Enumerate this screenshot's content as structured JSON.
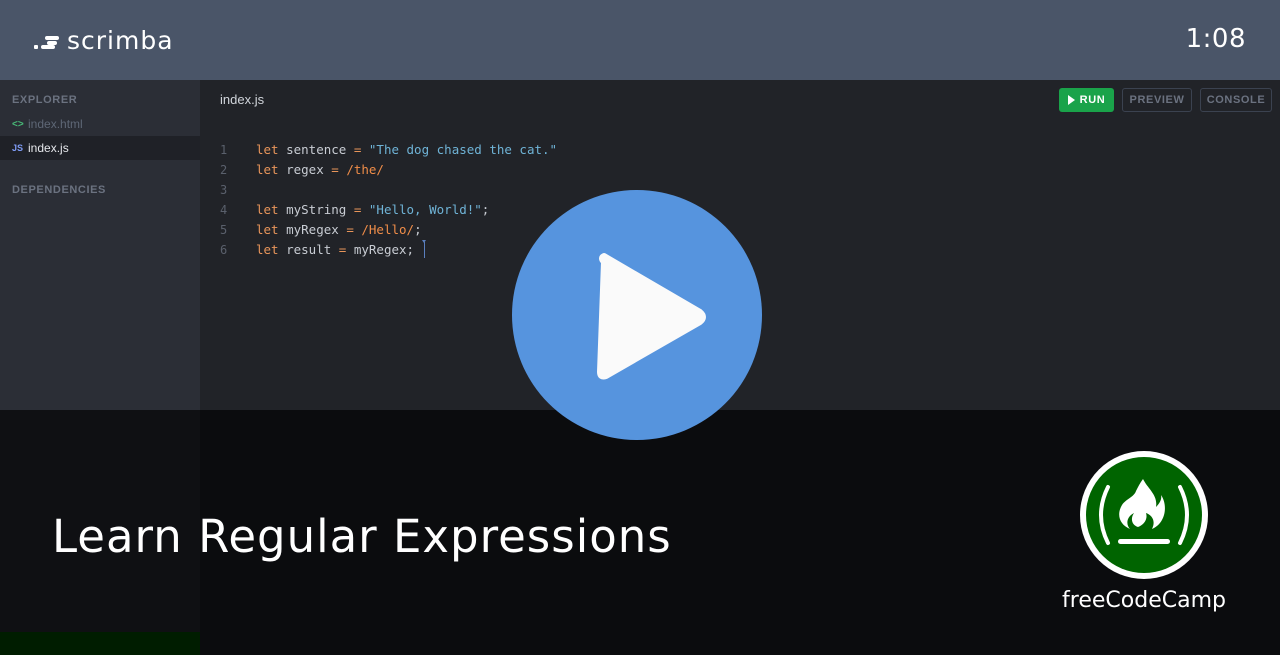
{
  "header": {
    "brand": "scrimba",
    "timer": "1:08"
  },
  "sidebar": {
    "explorer_title": "EXPLORER",
    "files": [
      {
        "name": "index.html",
        "icon": "code-brackets-icon",
        "active": false
      },
      {
        "name": "index.js",
        "icon": "js-icon",
        "active": true
      }
    ],
    "dependencies_title": "DEPENDENCIES",
    "html_icon_glyph": "<>",
    "js_icon_glyph": "JS"
  },
  "editor": {
    "tab_name": "index.js",
    "buttons": {
      "run": "RUN",
      "preview": "PREVIEW",
      "console": "CONSOLE"
    },
    "lines": [
      {
        "n": "1",
        "tokens": [
          [
            "kw",
            "let"
          ],
          [
            "tx",
            " sentence "
          ],
          [
            "kw",
            "="
          ],
          [
            "tx",
            " "
          ],
          [
            "str",
            "\"The dog chased the cat.\""
          ]
        ]
      },
      {
        "n": "2",
        "tokens": [
          [
            "kw",
            "let"
          ],
          [
            "tx",
            " regex "
          ],
          [
            "kw",
            "="
          ],
          [
            "tx",
            " "
          ],
          [
            "re",
            "/the/"
          ]
        ]
      },
      {
        "n": "3",
        "tokens": []
      },
      {
        "n": "4",
        "tokens": [
          [
            "kw",
            "let"
          ],
          [
            "tx",
            " myString "
          ],
          [
            "kw",
            "="
          ],
          [
            "tx",
            " "
          ],
          [
            "str",
            "\"Hello, World!\""
          ],
          [
            "tx",
            ";"
          ]
        ]
      },
      {
        "n": "5",
        "tokens": [
          [
            "kw",
            "let"
          ],
          [
            "tx",
            " myRegex "
          ],
          [
            "kw",
            "="
          ],
          [
            "tx",
            " "
          ],
          [
            "re",
            "/Hello/"
          ],
          [
            "tx",
            ";"
          ]
        ]
      },
      {
        "n": "6",
        "tokens": [
          [
            "kw",
            "let"
          ],
          [
            "tx",
            " result "
          ],
          [
            "kw",
            "="
          ],
          [
            "tx",
            " myRegex; "
          ]
        ]
      }
    ]
  },
  "overlay": {
    "course_title": "Learn Regular Expressions",
    "author": "freeCodeCamp",
    "play_label": "Play"
  },
  "colors": {
    "header_bg": "#4a5568",
    "run_green": "#1aa34a",
    "play_blue": "#5897e2",
    "fcc_green": "#006400"
  }
}
